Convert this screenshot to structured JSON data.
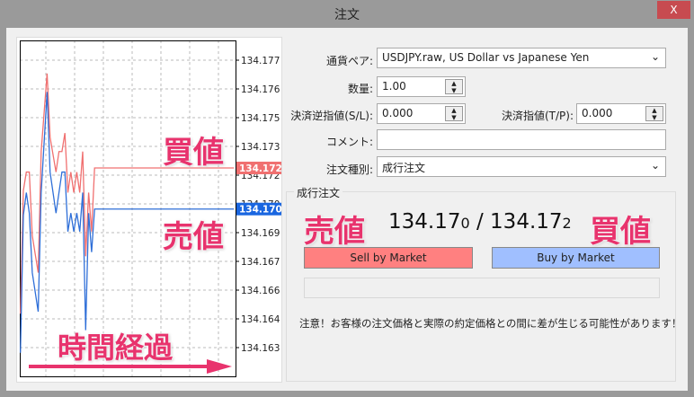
{
  "window": {
    "title": "注文",
    "close_label": "X"
  },
  "chart_data": {
    "type": "line",
    "y_tick_labels": [
      "134.177",
      "134.176",
      "134.175",
      "134.173",
      "134.172",
      "134.170",
      "134.169",
      "134.167",
      "134.166",
      "134.164",
      "134.163"
    ],
    "ylim": [
      134.163,
      134.177
    ],
    "grid": true,
    "series": [
      {
        "role": "ask",
        "color": "#f07070",
        "x": [
          0,
          1,
          2,
          3,
          4,
          6,
          7,
          9,
          10,
          12,
          13,
          14,
          15,
          16,
          17,
          18,
          19,
          20,
          21,
          22,
          23,
          24,
          25,
          72
        ],
        "y": [
          134.1649,
          134.1709,
          134.1718,
          134.1718,
          134.1687,
          134.1669,
          134.1728,
          134.1766,
          134.1735,
          134.1718,
          134.1728,
          134.1728,
          134.1737,
          134.1708,
          134.1718,
          134.1708,
          134.1718,
          134.1708,
          134.1728,
          134.1677,
          134.1708,
          134.1689,
          134.172,
          134.172
        ]
      },
      {
        "role": "bid",
        "color": "#2f6fd8",
        "x": [
          0,
          1,
          2,
          3,
          4,
          6,
          7,
          9,
          10,
          12,
          14,
          15,
          16,
          17,
          18,
          19,
          20,
          21,
          22,
          23,
          24,
          25,
          72
        ],
        "y": [
          134.163,
          134.1697,
          134.1708,
          134.1698,
          134.1669,
          134.165,
          134.1708,
          134.1757,
          134.1718,
          134.1698,
          134.1718,
          134.1718,
          134.1689,
          134.1698,
          134.1689,
          134.1698,
          134.1689,
          134.1708,
          134.1641,
          134.1698,
          134.1679,
          134.17,
          134.17
        ]
      }
    ],
    "ask_marker": "134.172",
    "bid_marker": "134.170"
  },
  "annotations": {
    "ask": "買値",
    "bid": "売値",
    "time": "時間経過",
    "ask2": "買値",
    "bid2": "売値",
    "color": "#e8336d"
  },
  "form": {
    "symbol_label": "通貨ペア:",
    "symbol_value": "USDJPY.raw, US Dollar vs Japanese Yen",
    "volume_label": "数量:",
    "volume_value": "1.00",
    "sl_label": "決済逆指値(S/L):",
    "sl_value": "0.000",
    "tp_label": "決済指値(T/P):",
    "tp_value": "0.000",
    "comment_label": "コメント:",
    "comment_value": "",
    "type_label": "注文種別:",
    "type_value": "成行注文"
  },
  "market": {
    "group_label": "成行注文",
    "bid_main": "134.17",
    "bid_last": "0",
    "sep": " / ",
    "ask_main": "134.17",
    "ask_last": "2",
    "sell_label": "Sell by Market",
    "buy_label": "Buy by Market",
    "sell_color": "#ff8080",
    "buy_color": "#a0bfff",
    "warning": "注意！お客様の注文価格と実際の約定価格との間に差が生じる可能性があります！"
  }
}
